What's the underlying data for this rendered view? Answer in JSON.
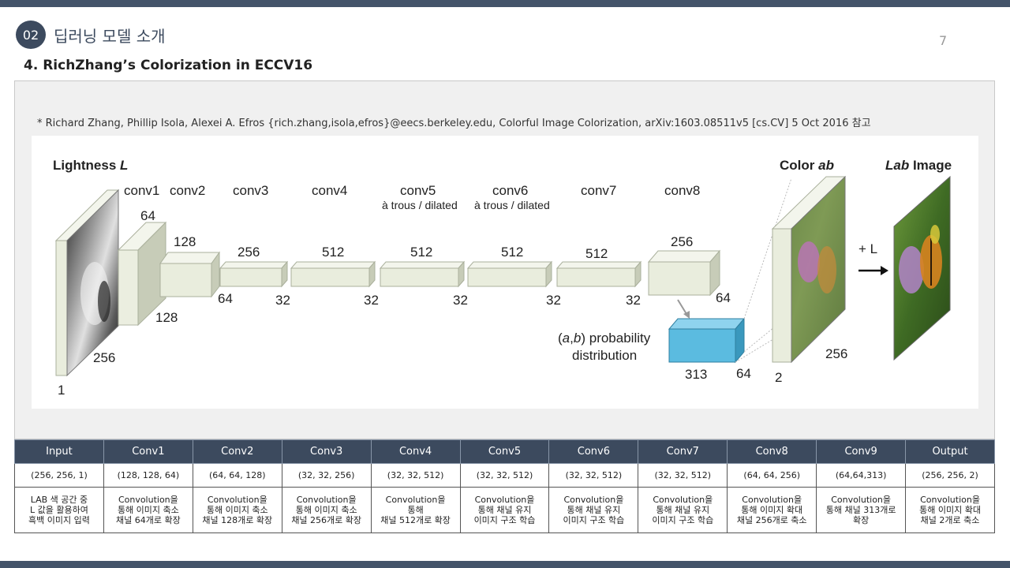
{
  "header": {
    "section_number": "02",
    "section_title": "딥러닝 모델 소개",
    "page_number": "7",
    "subtitle": "4. RichZhang’s Colorization in ECCV16"
  },
  "reference": "* Richard Zhang, Phillip Isola, Alexei A. Efros {rich.zhang,isola,efros}@eecs.berkeley.edu,  Colorful Image Colorization,  arXiv:1603.08511v5  [cs.CV]  5 Oct 2016 참고",
  "diagram": {
    "input_label_prefix": "Lightness ",
    "input_label_var": "L",
    "color_label_prefix": "Color ",
    "color_label_var": "ab",
    "output_label_var": "Lab",
    "output_label_suffix": " Image",
    "layers": [
      "conv1",
      "conv2",
      "conv3",
      "conv4",
      "conv5",
      "conv6",
      "conv7",
      "conv8"
    ],
    "dilated_note": "à trous / dilated",
    "input_dims": {
      "width": "1",
      "height": "256"
    },
    "conv1_channels": "64",
    "conv1_size": "128",
    "conv2_channels": "128",
    "conv2_size": "64",
    "conv3_channels": "256",
    "conv3_size": "32",
    "conv4_channels": "512",
    "conv4_size": "32",
    "conv5_channels": "512",
    "conv5_size": "32",
    "conv6_channels": "512",
    "conv6_size": "32",
    "conv7_channels": "512",
    "conv7_size": "32",
    "conv8_channels": "256",
    "conv8_size": "64",
    "prob_label_line1_a": "a",
    "prob_label_line1_b": "b",
    "prob_label_line1_rest": " probability",
    "prob_label_line2": "distribution",
    "prob_depth": "313",
    "prob_size": "64",
    "color_channels": "2",
    "color_size": "256",
    "plus_l": "+ L",
    "colors": {
      "block_face": "#e9eddd",
      "block_top": "#f3f5ec",
      "block_side": "#c7ccb8",
      "prob_face": "#5bbbe0",
      "prob_top": "#8fd3ee",
      "prob_side": "#3a98bd"
    }
  },
  "table": {
    "headers": [
      "Input",
      "Conv1",
      "Conv2",
      "Conv3",
      "Conv4",
      "Conv5",
      "Conv6",
      "Conv7",
      "Conv8",
      "Conv9",
      "Output"
    ],
    "shapes": [
      "(256, 256, 1)",
      "(128, 128, 64)",
      "(64, 64, 128)",
      "(32, 32, 256)",
      "(32, 32, 512)",
      "(32, 32, 512)",
      "(32, 32, 512)",
      "(32, 32, 512)",
      "(64, 64, 256)",
      "(64,64,313)",
      "(256, 256, 2)"
    ],
    "descriptions": [
      "LAB 색 공간 중\nL 값을 활용하여\n흑백 이미지 입력",
      "Convolution을\n통해 이미지 축소\n채널 64개로 확장",
      "Convolution을\n통해 이미지 축소\n채널 128개로 확장",
      "Convolution을\n통해 이미지 축소\n채널 256개로 확장",
      "Convolution을\n통해\n채널 512개로 확장",
      "Convolution을\n통해 채널 유지\n이미지 구조 학습",
      "Convolution을\n통해 채널 유지\n이미지 구조 학습",
      "Convolution을\n통해 채널 유지\n이미지 구조 학습",
      "Convolution을\n통해 이미지 확대\n채널 256개로 축소",
      "Convolution을\n통해 채널 313개로\n확장",
      "Convolution을\n통해 이미지 확대\n채널 2개로 축소"
    ]
  }
}
